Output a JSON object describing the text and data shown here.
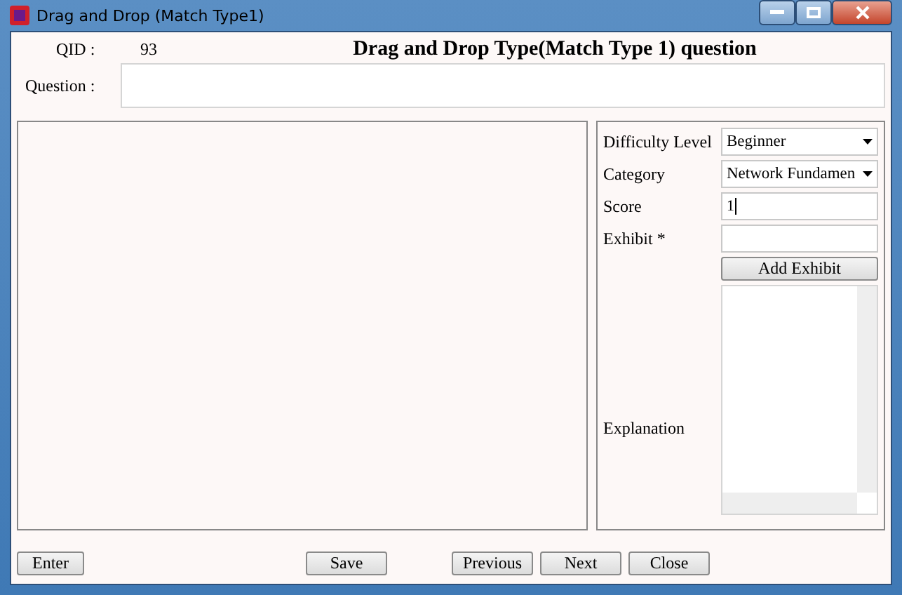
{
  "window": {
    "title": "Drag and Drop (Match Type1)"
  },
  "qid": {
    "label": "QID :",
    "value": "93"
  },
  "heading": "Drag and Drop Type(Match Type 1) question",
  "question": {
    "label": "Question :"
  },
  "side": {
    "difficulty": {
      "label": "Difficulty Level",
      "value": "Beginner"
    },
    "category": {
      "label": "Category",
      "value": "Network Fundamen"
    },
    "score": {
      "label": "Score",
      "value": "1"
    },
    "exhibit": {
      "label": "Exhibit *"
    },
    "add_exhibit": "Add Exhibit",
    "explanation": {
      "label": "Explanation"
    }
  },
  "buttons": {
    "left": [
      "Enter"
    ],
    "middle": [
      "Save"
    ],
    "right": [
      "Previous",
      "Next",
      "Close"
    ]
  }
}
